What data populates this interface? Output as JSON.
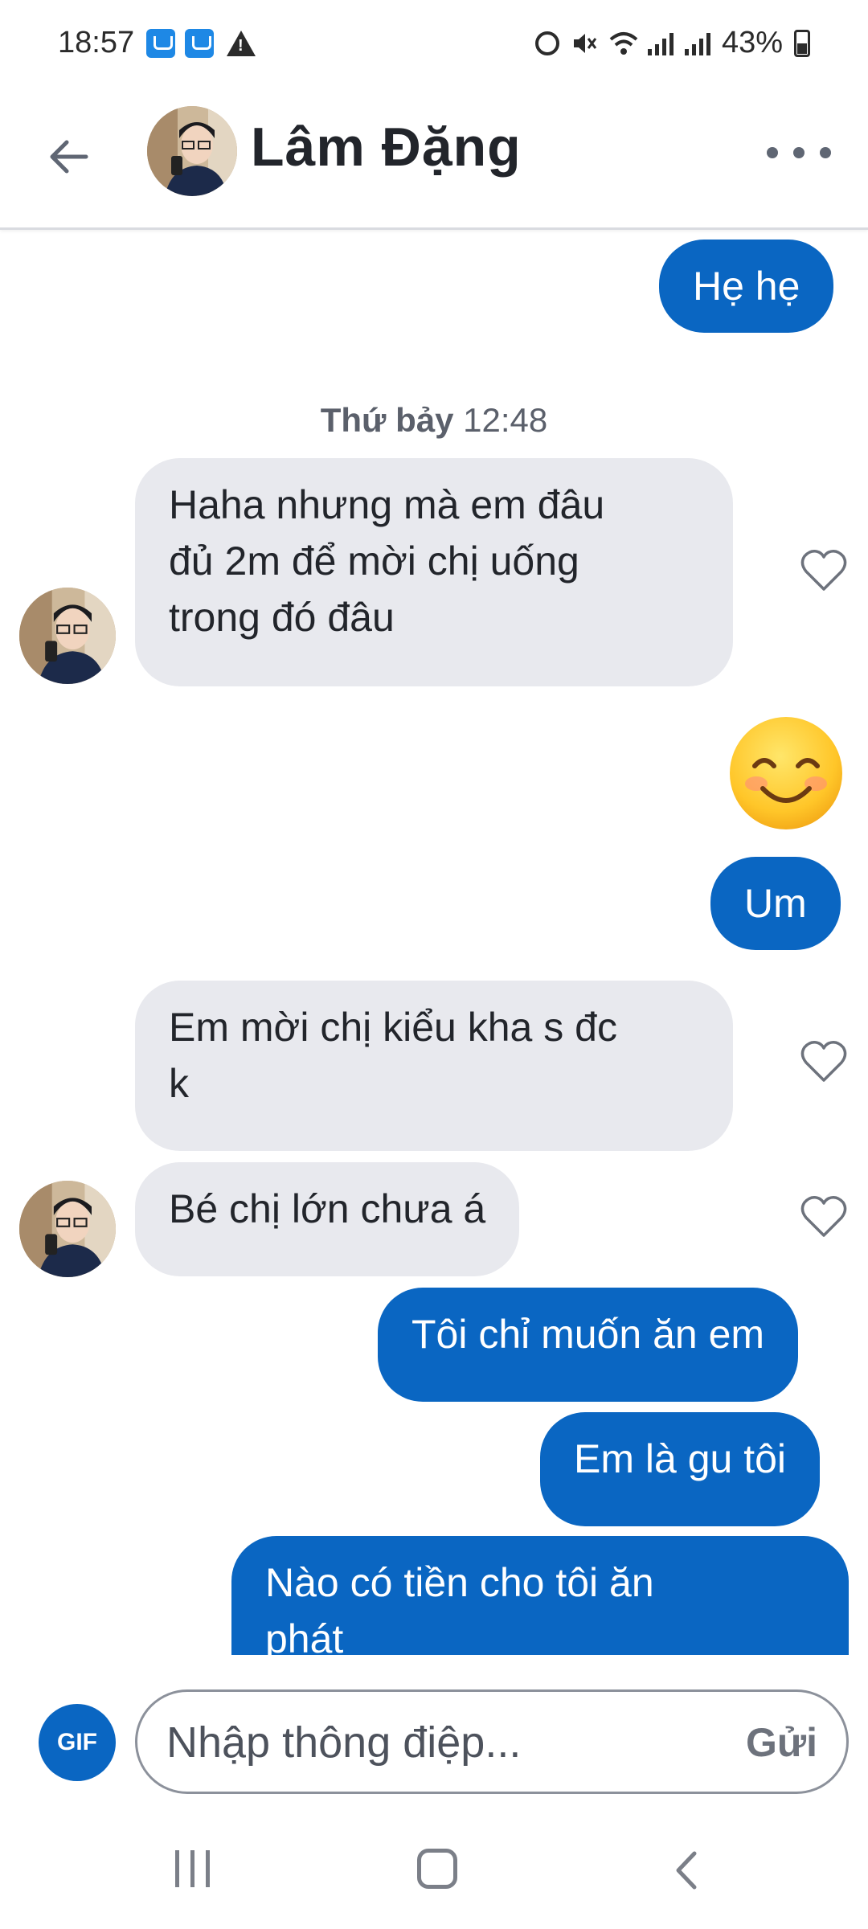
{
  "status_bar": {
    "time": "18:57",
    "battery": "43%",
    "battery_level_pct": 43,
    "left_icons": [
      "gallery-icon",
      "gallery-icon",
      "warning-icon"
    ],
    "right_icons": [
      "alarm-icon",
      "mute-icon",
      "wifi-icon",
      "signal-icon",
      "signal-icon",
      "battery-icon"
    ]
  },
  "header": {
    "contact_name": "Lâm Đặng",
    "back_icon": "arrow-left-icon",
    "more_icon": "more-horizontal-icon"
  },
  "conversation": {
    "time_divider_day": "Thứ bảy",
    "time_divider_time": "12:48",
    "messages": [
      {
        "direction": "outgoing",
        "text": "Hẹ hẹ"
      },
      {
        "direction": "incoming",
        "text": "Haha nhưng mà em đâu đủ 2m để mời chị uống trong đó đâu",
        "line1": "Haha nhưng mà em đâu",
        "line2": "đủ 2m để mời chị uống",
        "line3": "trong đó đâu"
      },
      {
        "direction": "outgoing",
        "type": "emoji",
        "emoji": "smiling-face-emoji"
      },
      {
        "direction": "outgoing",
        "text": "Um"
      },
      {
        "direction": "incoming",
        "text": "Em mời chị kiểu kha s đc k",
        "line1": "Em mời chị kiểu kha s đc",
        "line2": "k"
      },
      {
        "direction": "incoming",
        "text": "Bé chị lớn chưa á"
      },
      {
        "direction": "outgoing",
        "text": "Tôi chỉ muốn ăn em"
      },
      {
        "direction": "outgoing",
        "text": "Em là gu tôi"
      },
      {
        "direction": "outgoing",
        "text": "Nào có tiền cho tôi ăn phát",
        "line1": "Nào có tiền cho tôi ăn",
        "line2": "phát"
      }
    ]
  },
  "composer": {
    "gif_label": "GIF",
    "placeholder": "Nhập thông điệp...",
    "send_label": "Gửi"
  },
  "nav_bar": {
    "icons": [
      "recents-icon",
      "home-icon",
      "back-icon"
    ]
  },
  "colors": {
    "outgoing_bubble": "#0a66c2",
    "incoming_bubble": "#e8e9ee",
    "accent": "#0a66c2"
  }
}
